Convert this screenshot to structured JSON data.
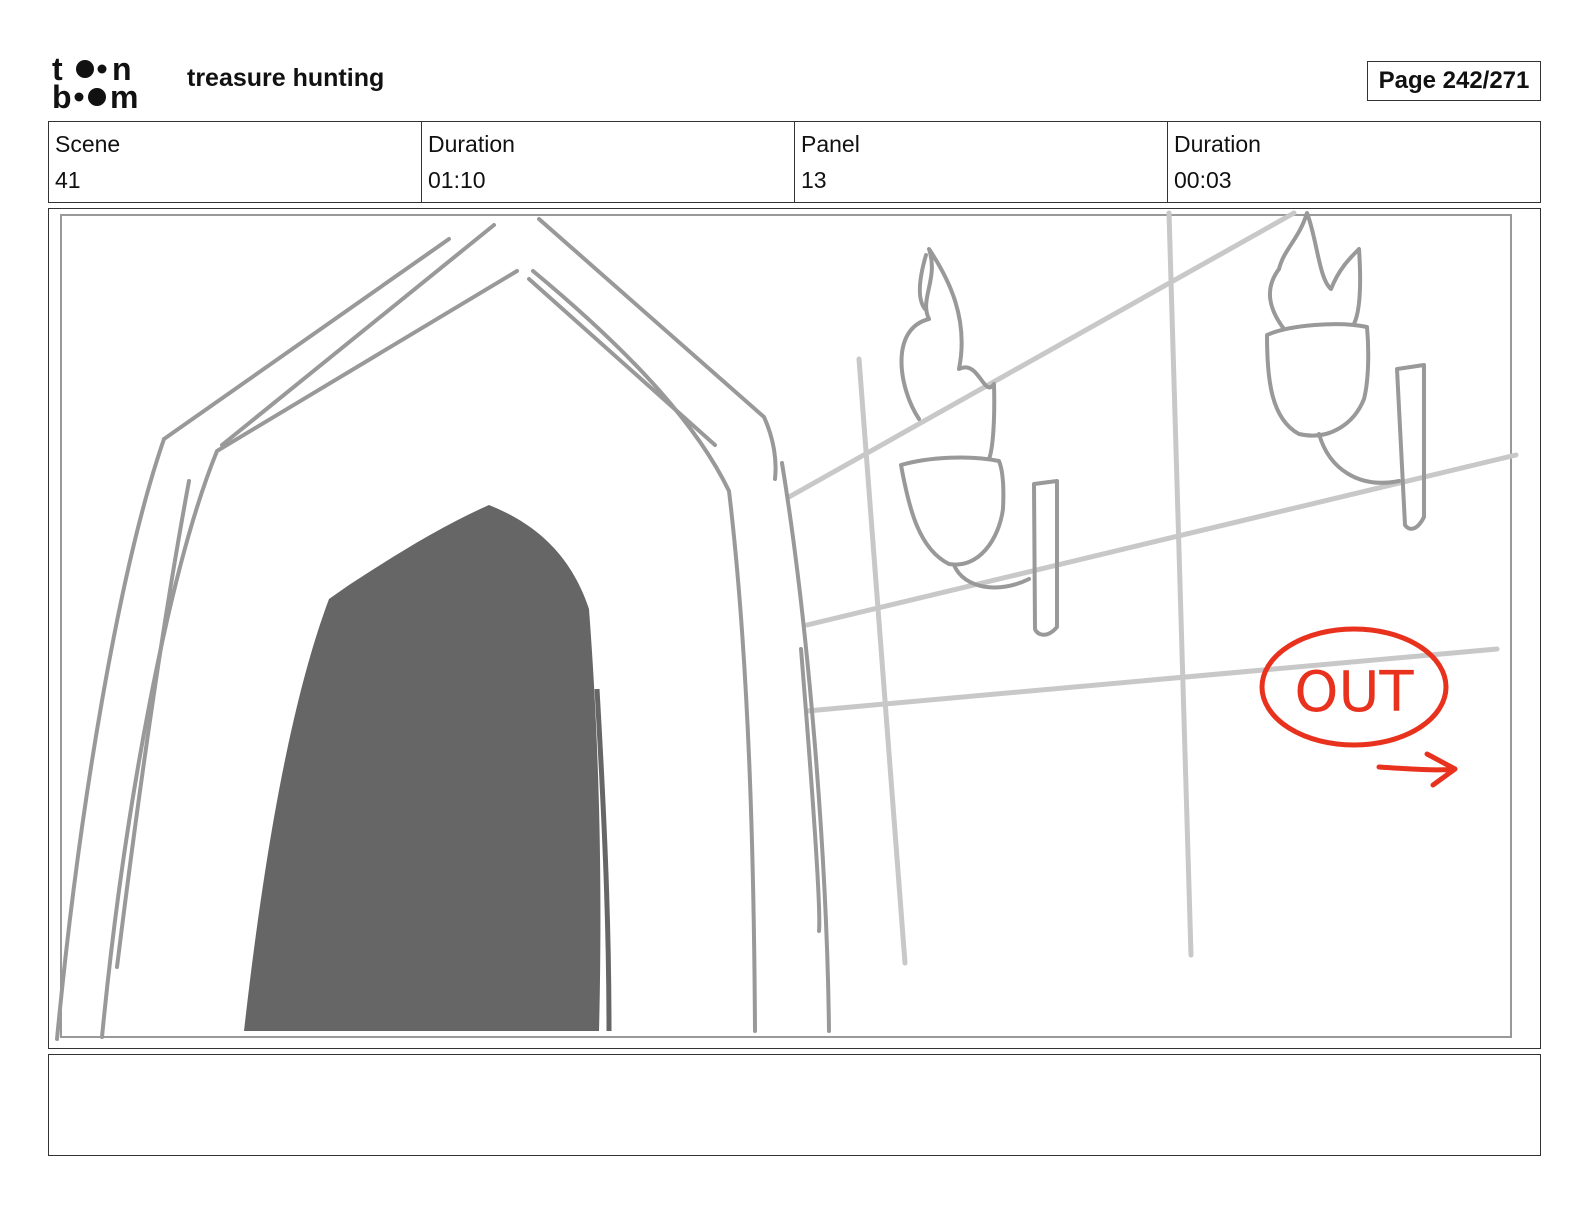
{
  "header": {
    "logo_alt": "toon boom",
    "project_title": "treasure hunting",
    "page_label": "Page 242/271"
  },
  "info": {
    "scene_label": "Scene",
    "scene_value": "41",
    "scene_duration_label": "Duration",
    "scene_duration_value": "01:10",
    "panel_label": "Panel",
    "panel_value": "13",
    "panel_duration_label": "Duration",
    "panel_duration_value": "00:03"
  },
  "panel": {
    "annotation_text": "OUT",
    "annotation_color": "#e8321e",
    "sketch_color": "#999999",
    "doorway_fill": "#666666",
    "grid_color": "#c8c8c8"
  },
  "notes": {
    "text": ""
  }
}
